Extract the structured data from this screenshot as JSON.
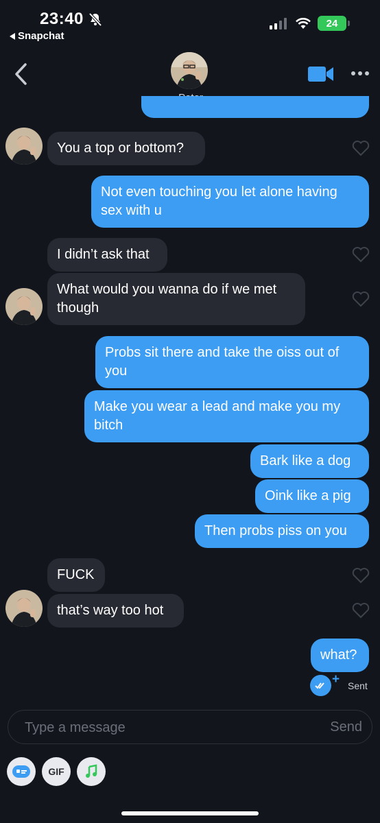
{
  "status_bar": {
    "time": "23:40",
    "back_app": "Snapchat",
    "battery": "24"
  },
  "header": {
    "contact_name": "Peter"
  },
  "messages": [
    {
      "text": "You a top or bottom?"
    },
    {
      "text": "Not even touching you let alone having sex with u"
    },
    {
      "text": "I didn’t ask that"
    },
    {
      "text": "What would you wanna do if we met though"
    },
    {
      "text": "Probs sit there and take the oiss out of you"
    },
    {
      "text": "Make you wear a lead and make you my bitch"
    },
    {
      "text": "Bark like a dog"
    },
    {
      "text": "Oink like a pig"
    },
    {
      "text": "Then probs piss on you"
    },
    {
      "text": "FUCK"
    },
    {
      "text": "that’s way too hot"
    },
    {
      "text": "what?"
    }
  ],
  "delivery_status": "Sent",
  "composer": {
    "placeholder": "Type a message",
    "send_label": "Send"
  },
  "tools": {
    "gif_label": "GIF"
  },
  "colors": {
    "background": "#12151c",
    "incoming_bubble": "#272a32",
    "outgoing_bubble": "#3d9df2",
    "accent": "#3d9df2"
  }
}
